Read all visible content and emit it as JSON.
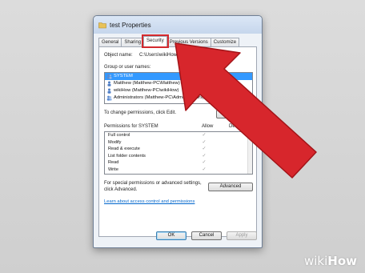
{
  "window": {
    "title": "test Properties"
  },
  "tabs": [
    {
      "label": "General"
    },
    {
      "label": "Sharing"
    },
    {
      "label": "Security",
      "active": true
    },
    {
      "label": "Previous Versions"
    },
    {
      "label": "Customize"
    }
  ],
  "object": {
    "label": "Object name:",
    "value": "C:\\Users\\wikiHow\\Desktop\\test"
  },
  "groups": {
    "label": "Group or user names:",
    "items": [
      {
        "name": "SYSTEM",
        "selected": true
      },
      {
        "name": "Matthew (Matthew-PC\\Matthew)"
      },
      {
        "name": "wikiHow (Matthew-PC\\wikiHow)"
      },
      {
        "name": "Administrators (Matthew-PC\\Administrators)"
      }
    ]
  },
  "change_hint": "To change permissions, click Edit.",
  "edit_button": "Edit...",
  "permissions": {
    "header": "Permissions for SYSTEM",
    "allow_header": "Allow",
    "deny_header": "Deny",
    "rows": [
      {
        "name": "Full control",
        "allow": "✓"
      },
      {
        "name": "Modify",
        "allow": "✓"
      },
      {
        "name": "Read & execute",
        "allow": "✓"
      },
      {
        "name": "List folder contents",
        "allow": "✓"
      },
      {
        "name": "Read",
        "allow": "✓"
      },
      {
        "name": "Write",
        "allow": "✓"
      }
    ]
  },
  "special": {
    "line1": "For special permissions or advanced settings,",
    "line2": "click Advanced.",
    "button": "Advanced"
  },
  "learn_link": "Learn about access control and permissions",
  "footer": {
    "ok": "OK",
    "cancel": "Cancel",
    "apply": "Apply"
  },
  "watermark": {
    "wiki": "wiki",
    "how": "How"
  },
  "colors": {
    "highlight": "#d32a2f",
    "selection": "#3399ff",
    "arrow": "#d7262c"
  }
}
